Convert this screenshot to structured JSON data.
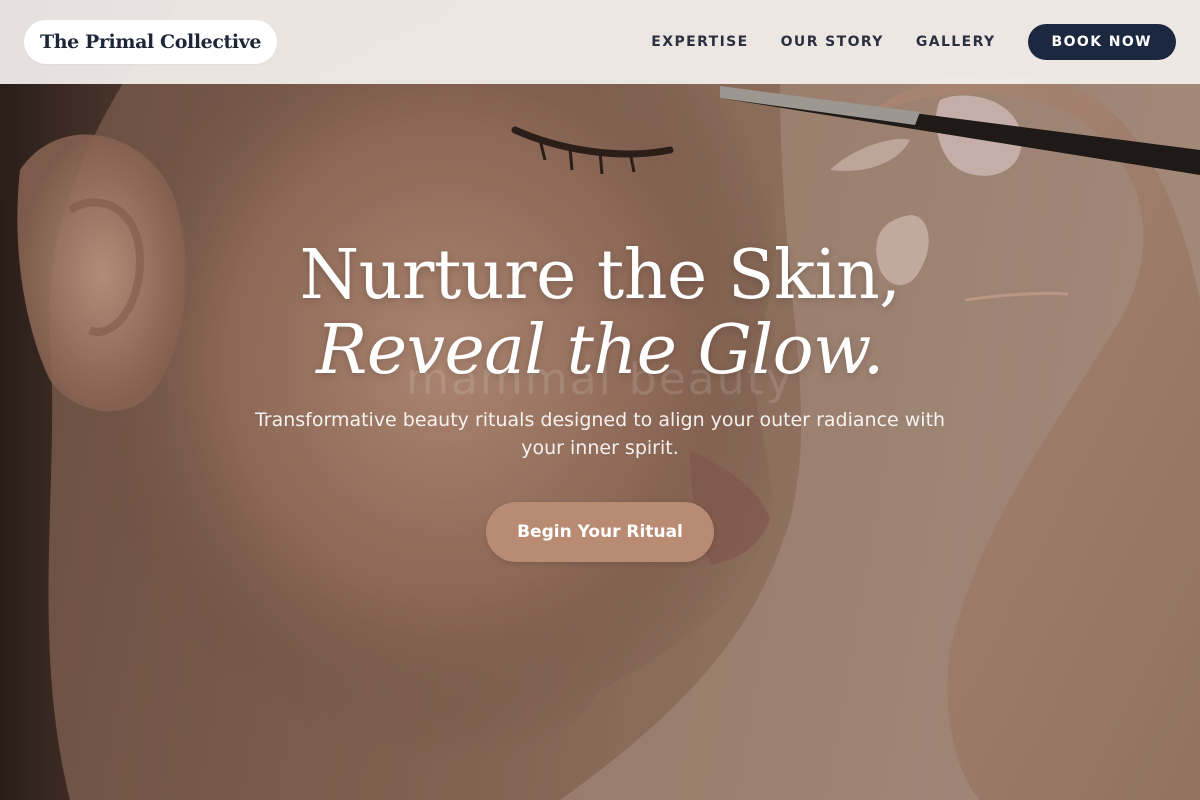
{
  "brand": {
    "name": "The Primal Collective"
  },
  "nav": {
    "links": [
      "EXPERTISE",
      "OUR STORY",
      "GALLERY"
    ],
    "book_label": "BOOK NOW"
  },
  "hero": {
    "headline_line1": "Nurture the Skin,",
    "headline_line2": "Reveal the Glow.",
    "watermark": "mammal beauty",
    "tagline": "Transformative beauty rituals designed to align your outer radiance with your inner spirit.",
    "cta_label": "Begin Your Ritual",
    "image_description": "Close-up profile of a woman with eyes closed while a makeup brush is applied to her brow"
  },
  "colors": {
    "navy": "#1c2840",
    "accent_tan": "#b98b72",
    "nav_bg": "#f4f0ee"
  }
}
